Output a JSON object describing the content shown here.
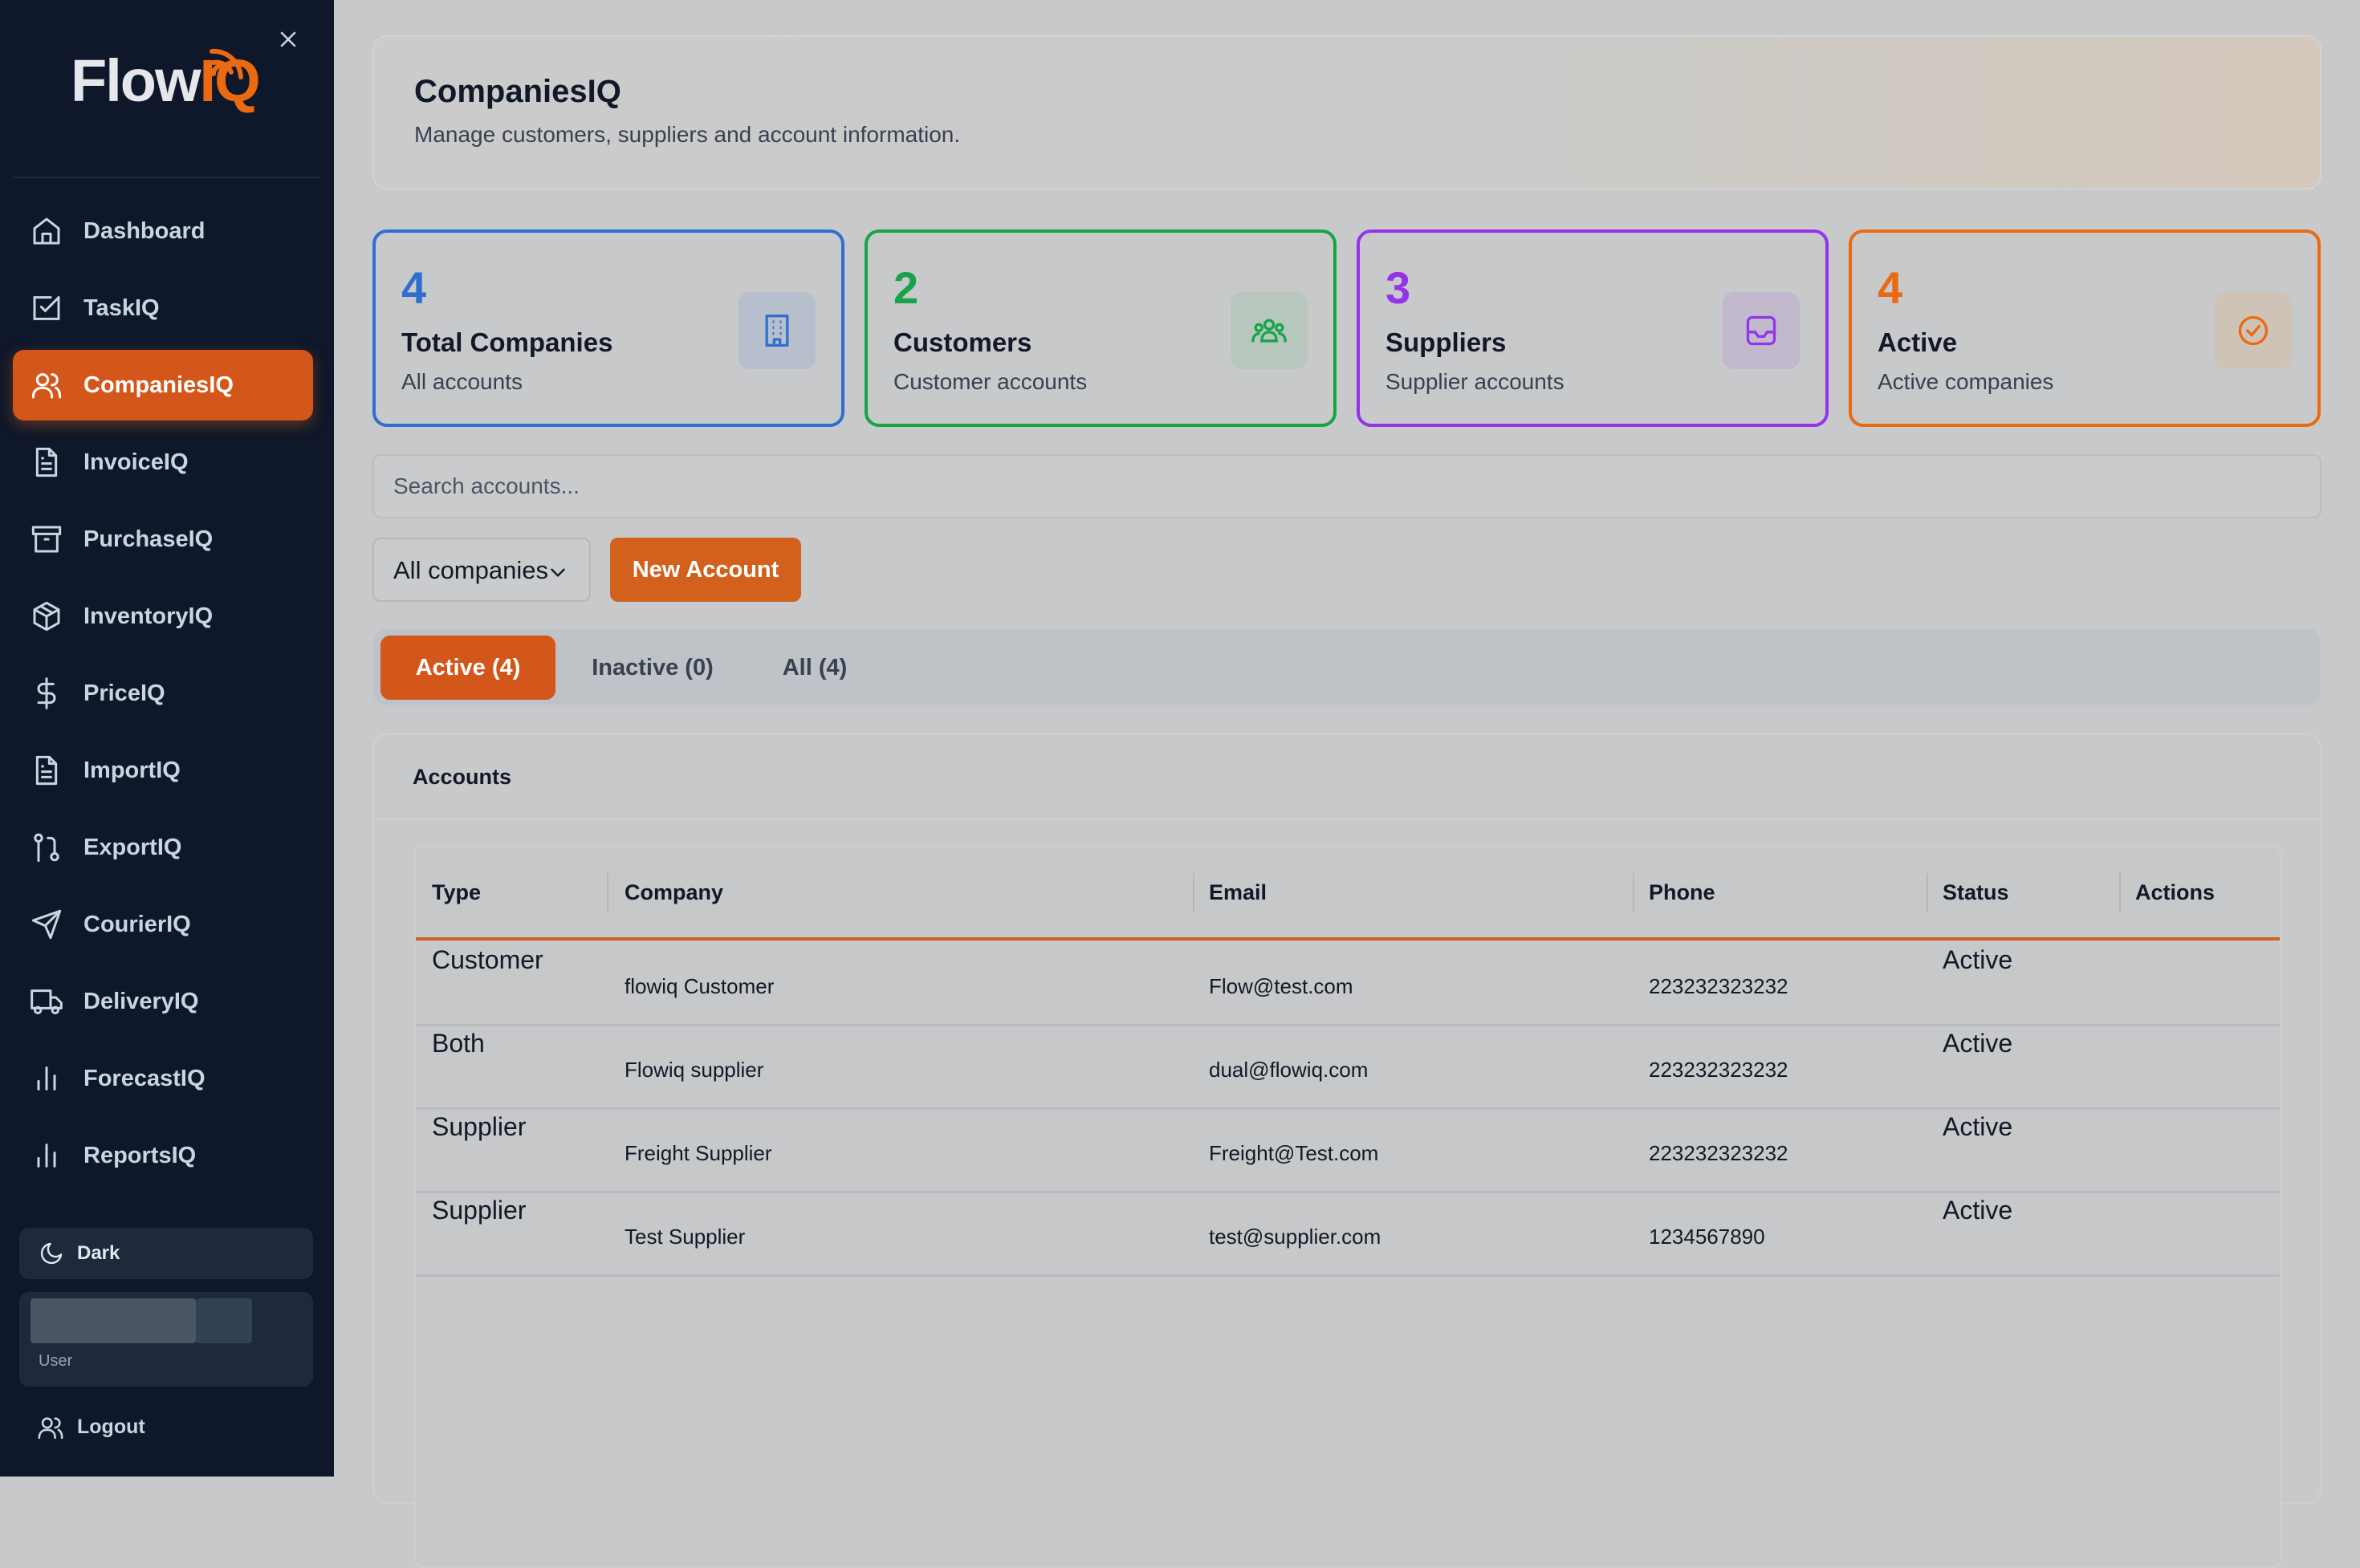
{
  "brand": {
    "name_main": "Flow",
    "name_accent": "IQ"
  },
  "sidebar": {
    "items": [
      {
        "label": "Dashboard",
        "icon": "home-icon"
      },
      {
        "label": "TaskIQ",
        "icon": "checkbox-icon"
      },
      {
        "label": "CompaniesIQ",
        "icon": "users-icon",
        "active": true
      },
      {
        "label": "InvoiceIQ",
        "icon": "file-icon"
      },
      {
        "label": "PurchaseIQ",
        "icon": "archive-icon"
      },
      {
        "label": "InventoryIQ",
        "icon": "package-icon"
      },
      {
        "label": "PriceIQ",
        "icon": "dollar-icon"
      },
      {
        "label": "ImportIQ",
        "icon": "file-text-icon"
      },
      {
        "label": "ExportIQ",
        "icon": "git-pull-icon"
      },
      {
        "label": "CourierIQ",
        "icon": "send-icon"
      },
      {
        "label": "DeliveryIQ",
        "icon": "truck-icon"
      },
      {
        "label": "ForecastIQ",
        "icon": "bar-chart-icon"
      },
      {
        "label": "ReportsIQ",
        "icon": "bar-chart-icon"
      }
    ],
    "theme_label": "Dark",
    "user_role": "User",
    "logout_label": "Logout"
  },
  "header": {
    "title": "CompaniesIQ",
    "subtitle": "Manage customers, suppliers and account information."
  },
  "stats": [
    {
      "value": "4",
      "label": "Total Companies",
      "desc": "All accounts",
      "color": "#2f6fd0",
      "icon": "building-icon"
    },
    {
      "value": "2",
      "label": "Customers",
      "desc": "Customer accounts",
      "color": "#16a34a",
      "icon": "users-group-icon"
    },
    {
      "value": "3",
      "label": "Suppliers",
      "desc": "Supplier accounts",
      "color": "#9333ea",
      "icon": "inbox-icon"
    },
    {
      "value": "4",
      "label": "Active",
      "desc": "Active companies",
      "color": "#ea6a12",
      "icon": "check-circle-icon"
    }
  ],
  "search": {
    "placeholder": "Search accounts...",
    "value": ""
  },
  "filter": {
    "selected": "All companies"
  },
  "new_account_label": "New Account",
  "tabs": [
    {
      "label": "Active (4)",
      "active": true
    },
    {
      "label": "Inactive (0)"
    },
    {
      "label": "All (4)"
    }
  ],
  "accounts": {
    "title": "Accounts",
    "columns": [
      "Type",
      "Company",
      "Email",
      "Phone",
      "Status",
      "Actions"
    ],
    "rows": [
      {
        "type": "Customer",
        "company": "flowiq Customer",
        "email": "Flow@test.com",
        "phone": "223232323232",
        "status": "Active"
      },
      {
        "type": "Both",
        "company": "Flowiq supplier",
        "email": "dual@flowiq.com",
        "phone": "223232323232",
        "status": "Active"
      },
      {
        "type": "Supplier",
        "company": "Freight Supplier",
        "email": "Freight@Test.com",
        "phone": "223232323232",
        "status": "Active"
      },
      {
        "type": "Supplier",
        "company": "Test Supplier",
        "email": "test@supplier.com",
        "phone": "1234567890",
        "status": "Active"
      }
    ]
  },
  "colors": {
    "accent": "#ea6a12",
    "sidebar_bg": "#0f172a"
  }
}
